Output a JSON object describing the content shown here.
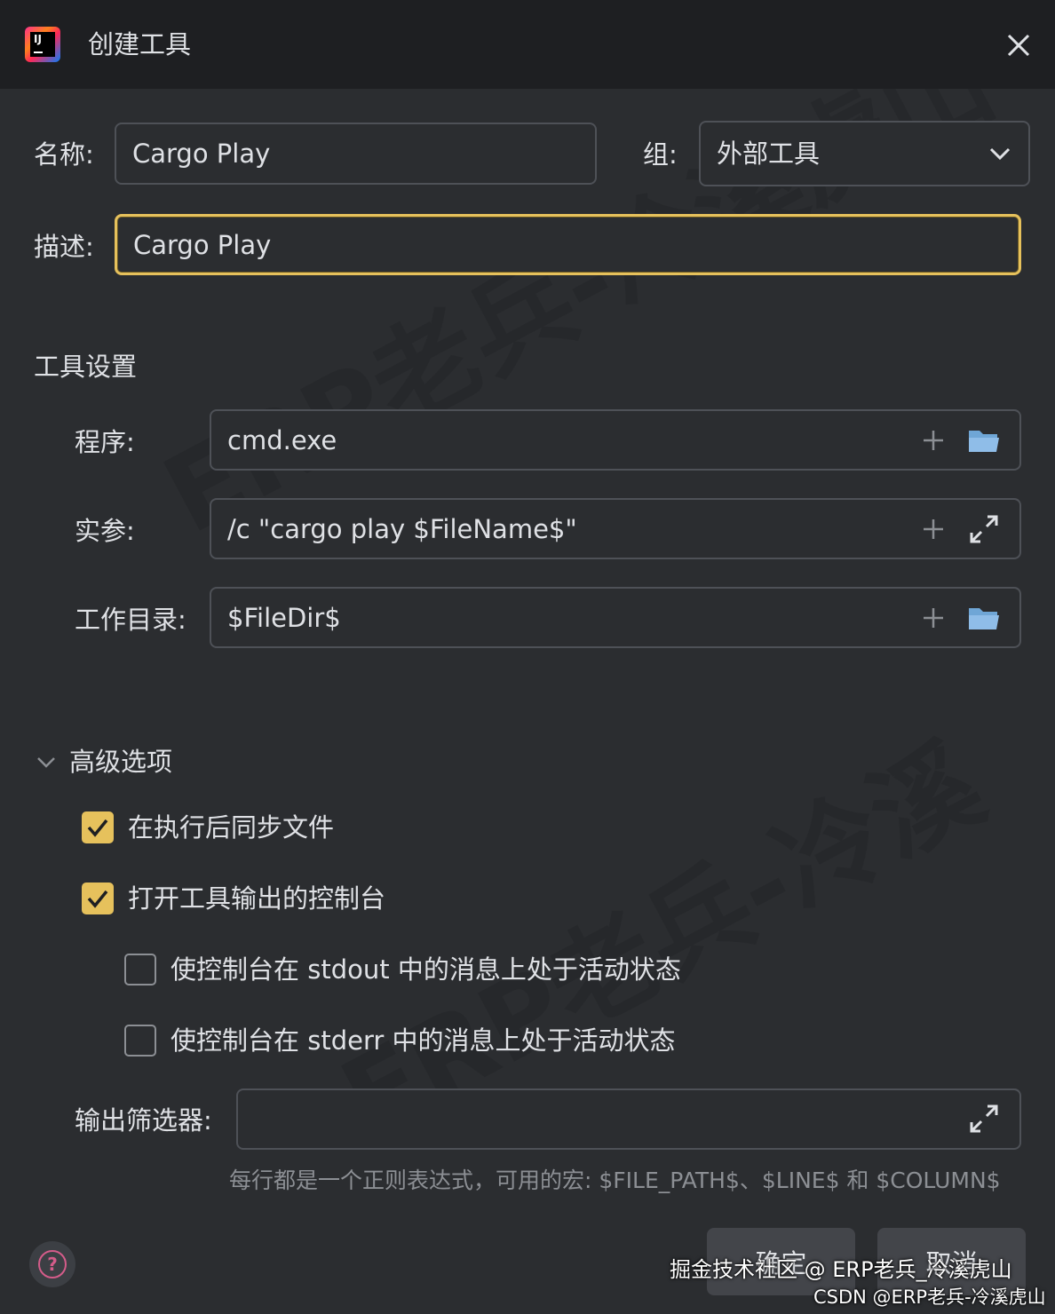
{
  "window": {
    "title": "创建工具"
  },
  "form": {
    "name_label": "名称:",
    "name_value": "Cargo Play",
    "group_label": "组:",
    "group_value": "外部工具",
    "desc_label": "描述:",
    "desc_value": "Cargo Play"
  },
  "tool_settings": {
    "title": "工具设置",
    "program_label": "程序:",
    "program_value": "cmd.exe",
    "args_label": "实参:",
    "args_value": "/c \"cargo play $FileName$\"",
    "workdir_label": "工作目录:",
    "workdir_value": "$FileDir$"
  },
  "advanced": {
    "title": "高级选项",
    "options": [
      {
        "label": "在执行后同步文件",
        "checked": true
      },
      {
        "label": "打开工具输出的控制台",
        "checked": true
      },
      {
        "label": "使控制台在 stdout 中的消息上处于活动状态",
        "checked": false
      },
      {
        "label": "使控制台在 stderr 中的消息上处于活动状态",
        "checked": false
      }
    ],
    "filter_label": "输出筛选器:",
    "filter_value": "",
    "hint": "每行都是一个正则表达式，可用的宏: $FILE_PATH$、$LINE$ 和 $COLUMN$"
  },
  "buttons": {
    "ok": "确定",
    "cancel": "取消"
  },
  "watermarks": {
    "juejin": "掘金技术社区 @ ERP老兵_冷溪虎山",
    "csdn": "CSDN @ERP老兵-冷溪虎山",
    "diagonal_1": "ERP老兵-冷溪虎山",
    "diagonal_2": "ERP老兵-冷溪"
  },
  "colors": {
    "accent": "#e6c15c",
    "background": "#2b2d30",
    "titlebar": "#1e1f22",
    "border": "#4e5157"
  },
  "icons": [
    "app-logo-icon",
    "close-icon",
    "chevron-down-icon",
    "plus-icon",
    "folder-icon",
    "expand-icon",
    "question-icon"
  ]
}
